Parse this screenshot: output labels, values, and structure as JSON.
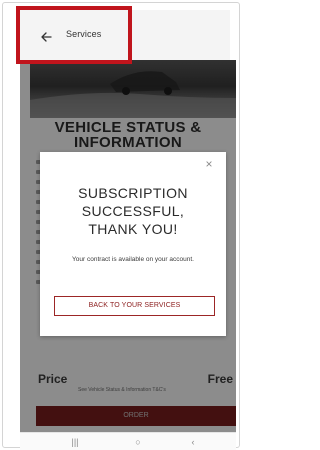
{
  "header": {
    "title": "Services",
    "back_icon": "arrow-left-icon"
  },
  "hero": {
    "heading_line1": "VEHICLE STATUS &",
    "heading_line2": "INFORMATION"
  },
  "modal": {
    "title_line1": "SUBSCRIPTION",
    "title_line2": "SUCCESSFUL,",
    "title_line3": "THANK YOU!",
    "message": "Your contract is available on your account.",
    "button_label": "BACK TO YOUR SERVICES",
    "close_icon": "close-icon"
  },
  "price": {
    "label": "Price",
    "value": "Free",
    "note": "See Vehicle Status & Information T&C's"
  },
  "order": {
    "label": "ORDER"
  },
  "navbar": {
    "recent_glyph": "|||",
    "home_glyph": "○",
    "back_glyph": "‹"
  },
  "colors": {
    "accent": "#8d2020",
    "highlight": "#c0141c"
  }
}
